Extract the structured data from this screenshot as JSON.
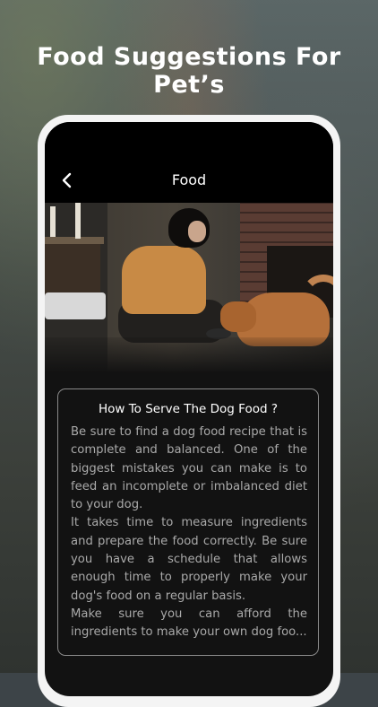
{
  "headline": "Food Suggestions For Pet’s",
  "appbar": {
    "back_icon": "chevron-left-icon",
    "title": "Food"
  },
  "card": {
    "heading": "How To Serve The Dog Food ?",
    "paragraphs": [
      "Be sure to find a dog food recipe that is complete and balanced. One of the biggest mistakes you can make is to feed an incomplete or imbalanced diet to your dog.",
      "It takes time to measure ingredients and prepare the food correctly. Be sure you have a schedule that allows enough time to properly make your dog's food on a regular basis.",
      "Make sure you can afford the ingredients to make your own dog foo..."
    ]
  },
  "colors": {
    "screen_bg": "#121212",
    "appbar_bg": "#000000",
    "card_border": "#8a8a8a",
    "body_text": "#a9a9a9"
  }
}
